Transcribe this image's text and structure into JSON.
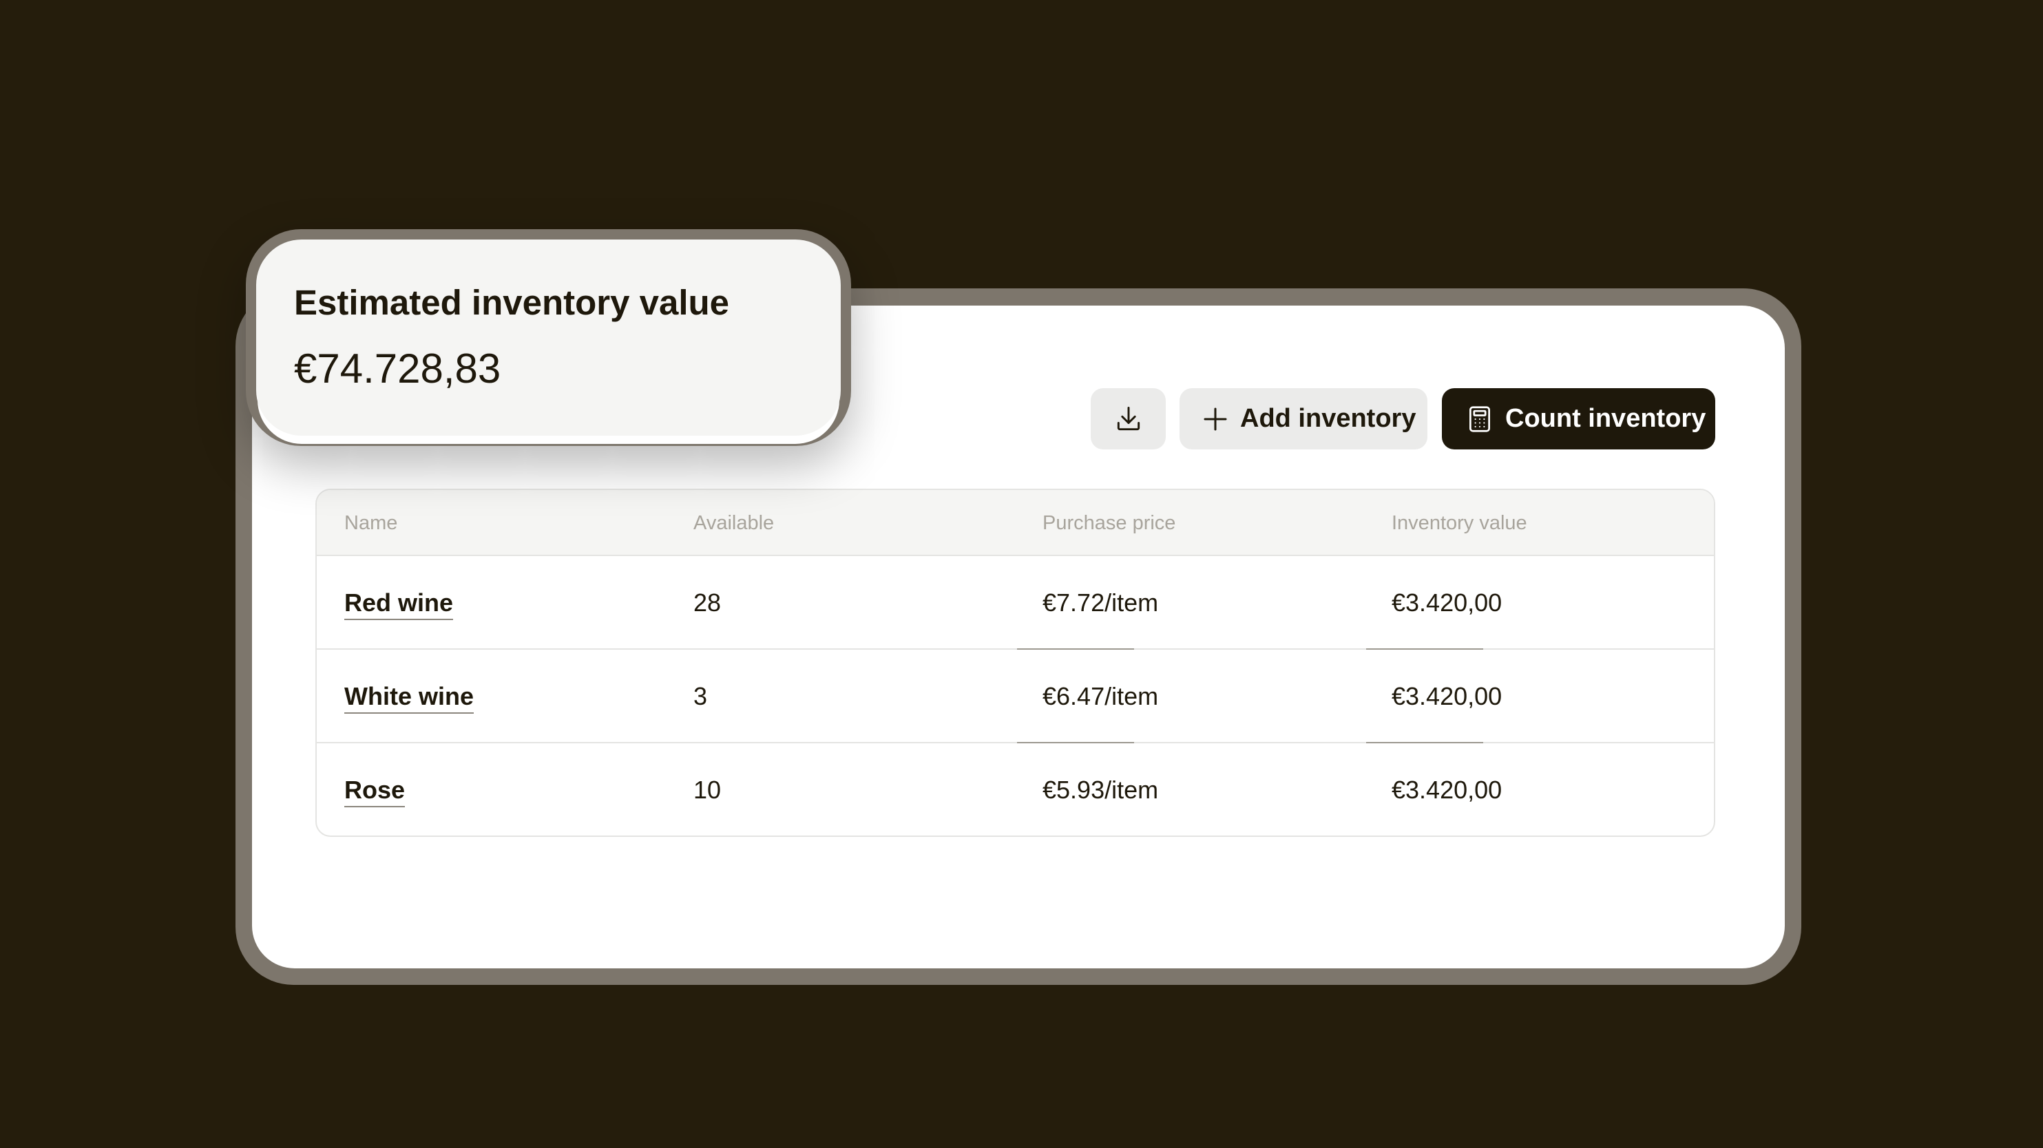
{
  "summary": {
    "title": "Estimated inventory value",
    "value": "€74.728,83"
  },
  "toolbar": {
    "download_icon": "download-icon",
    "add_icon": "plus-icon",
    "add_label": "Add inventory",
    "count_icon": "calculator-icon",
    "count_label": "Count inventory"
  },
  "table": {
    "headers": [
      "Name",
      "Available",
      "Purchase price",
      "Inventory value"
    ],
    "rows": [
      {
        "name": "Red wine",
        "available": "28",
        "purchase_price": "€7.72/item",
        "inventory_value": "€3.420,00"
      },
      {
        "name": "White wine",
        "available": "3",
        "purchase_price": "€6.47/item",
        "inventory_value": "€3.420,00"
      },
      {
        "name": "Rose",
        "available": "10",
        "purchase_price": "€5.93/item",
        "inventory_value": "€3.420,00"
      }
    ]
  },
  "colors": {
    "background": "#251d0c",
    "frame": "#7d766c",
    "card": "#ffffff",
    "panel": "#f5f5f3",
    "text": "#1e180b",
    "primary_button": "#1e180b",
    "secondary_button": "#ebebea",
    "header_text": "#a8a49c"
  }
}
